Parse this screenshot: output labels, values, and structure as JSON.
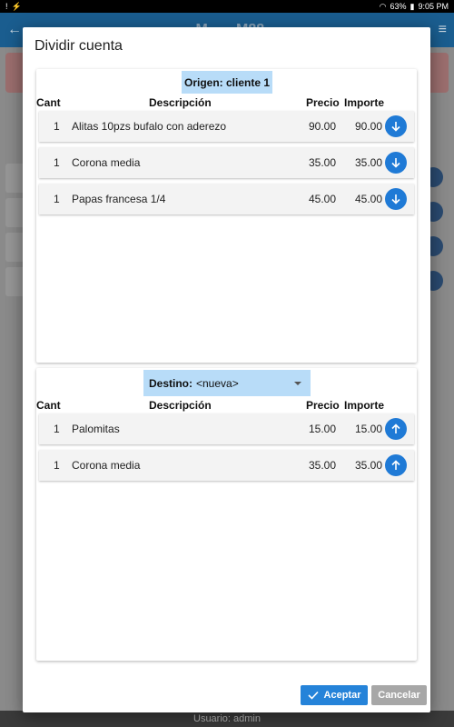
{
  "status": {
    "left_icons": [
      "alert-icon",
      "bolt-icon"
    ],
    "battery": "63%",
    "time": "9:05 PM"
  },
  "appbar": {
    "title": "M___ M88"
  },
  "footer": {
    "user_text": "Usuario: admin"
  },
  "dialog": {
    "title": "Dividir cuenta",
    "origin": {
      "label": "Origen: cliente 1",
      "headers": {
        "cant": "Cant",
        "desc": "Descripción",
        "precio": "Precio",
        "importe": "Importe"
      },
      "rows": [
        {
          "cant": "1",
          "desc": "Alitas 10pzs bufalo con aderezo",
          "precio": "90.00",
          "importe": "90.00"
        },
        {
          "cant": "1",
          "desc": "Corona media",
          "precio": "35.00",
          "importe": "35.00"
        },
        {
          "cant": "1",
          "desc": "Papas francesa 1/4",
          "precio": "45.00",
          "importe": "45.00"
        }
      ]
    },
    "dest": {
      "label_prefix": "Destino:",
      "selected": "<nueva>",
      "headers": {
        "cant": "Cant",
        "desc": "Descripción",
        "precio": "Precio",
        "importe": "Importe"
      },
      "rows": [
        {
          "cant": "1",
          "desc": "Palomitas",
          "precio": "15.00",
          "importe": "15.00"
        },
        {
          "cant": "1",
          "desc": "Corona media",
          "precio": "35.00",
          "importe": "35.00"
        }
      ]
    },
    "buttons": {
      "accept": "Aceptar",
      "cancel": "Cancelar"
    }
  },
  "colors": {
    "accent": "#2583d9",
    "tag": "#b8dcf8",
    "cancel": "#a7a7a7"
  }
}
